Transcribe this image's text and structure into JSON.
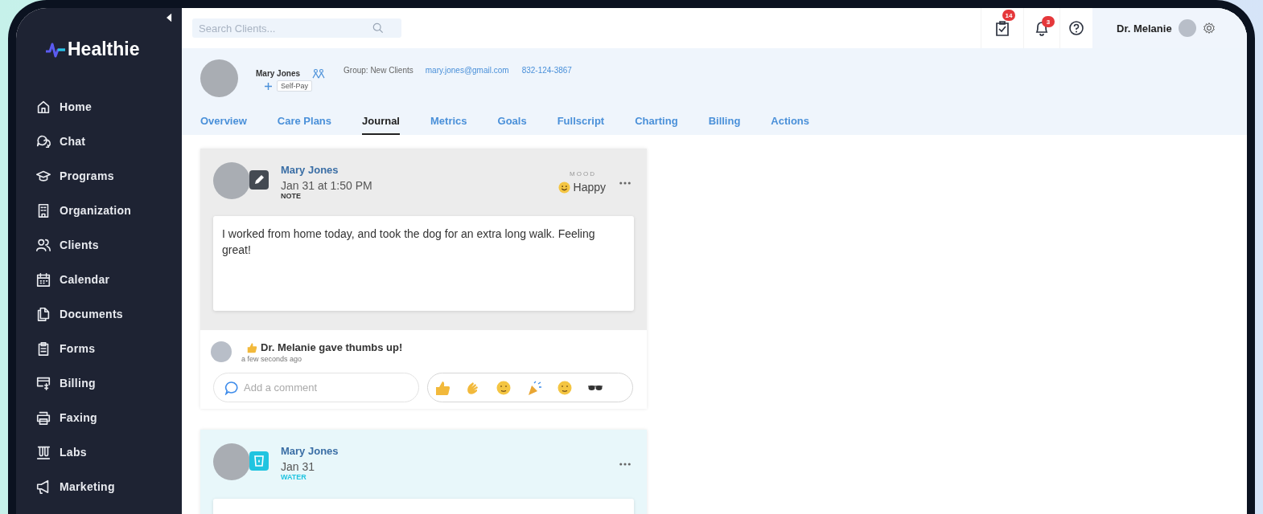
{
  "sidebar": {
    "logo": "Healthie",
    "items": [
      {
        "label": "Home",
        "selected": false
      },
      {
        "label": "Chat",
        "selected": false
      },
      {
        "label": "Programs",
        "selected": false
      },
      {
        "label": "Organization",
        "selected": false
      },
      {
        "label": "Clients",
        "selected": false
      },
      {
        "label": "Calendar",
        "selected": false
      },
      {
        "label": "Documents",
        "selected": false
      },
      {
        "label": "Forms",
        "selected": false
      },
      {
        "label": "Billing",
        "selected": false
      },
      {
        "label": "Faxing",
        "selected": false
      },
      {
        "label": "Labs",
        "selected": false
      },
      {
        "label": "Marketing",
        "selected": false
      }
    ]
  },
  "topbar": {
    "search": {
      "placeholder": "Search Clients..."
    },
    "tasks_badge": "14",
    "notifications_badge": "3",
    "user": "Dr. Melanie"
  },
  "client": {
    "name": "Mary Jones",
    "plan": "Self-Pay",
    "group": "Group: New Clients",
    "email": "mary.jones@gmail.com",
    "phone": "832-124-3867"
  },
  "tabs": [
    {
      "label": "Overview",
      "selected": false
    },
    {
      "label": "Care Plans",
      "selected": false
    },
    {
      "label": "Journal",
      "selected": true
    },
    {
      "label": "Metrics",
      "selected": false
    },
    {
      "label": "Goals",
      "selected": false
    },
    {
      "label": "Fullscript",
      "selected": false
    },
    {
      "label": "Charting",
      "selected": false
    },
    {
      "label": "Billing",
      "selected": false
    },
    {
      "label": "Actions",
      "selected": false
    }
  ],
  "entries": [
    {
      "kind": "note",
      "author": "Mary Jones",
      "date": "Jan 31 at 1:50 PM",
      "type_label": "NOTE",
      "mood_label": "MOOD",
      "mood": "Happy",
      "text": "I worked from home today, and took the dog for an extra long walk. Feeling great!",
      "reaction": {
        "text": "Dr. Melanie gave thumbs up!",
        "time": "a few seconds ago"
      },
      "comment": {
        "placeholder": "Add a comment"
      }
    },
    {
      "kind": "water",
      "author": "Mary Jones",
      "date": "Jan 31",
      "type_label": "WATER"
    }
  ]
}
